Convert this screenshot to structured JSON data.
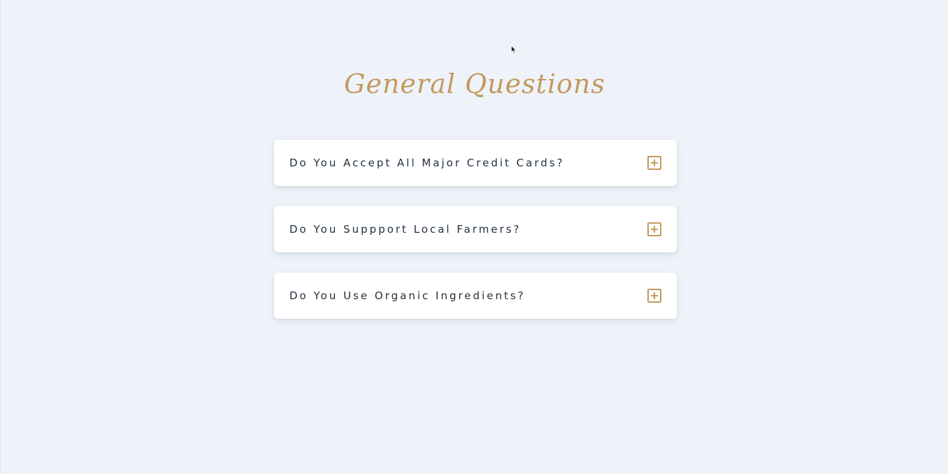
{
  "page": {
    "title": "General Questions",
    "accent_color": "#c39a5e",
    "text_color": "#22303f",
    "background_color": "#eef3f9"
  },
  "faq": {
    "items": [
      {
        "question": "Do You Accept All Major Credit Cards?",
        "icon": "plus-square-icon",
        "expanded": false
      },
      {
        "question": "Do You Suppport Local Farmers?",
        "icon": "plus-square-icon",
        "expanded": false
      },
      {
        "question": "Do You Use Organic Ingredients?",
        "icon": "plus-square-icon",
        "expanded": false
      }
    ]
  }
}
